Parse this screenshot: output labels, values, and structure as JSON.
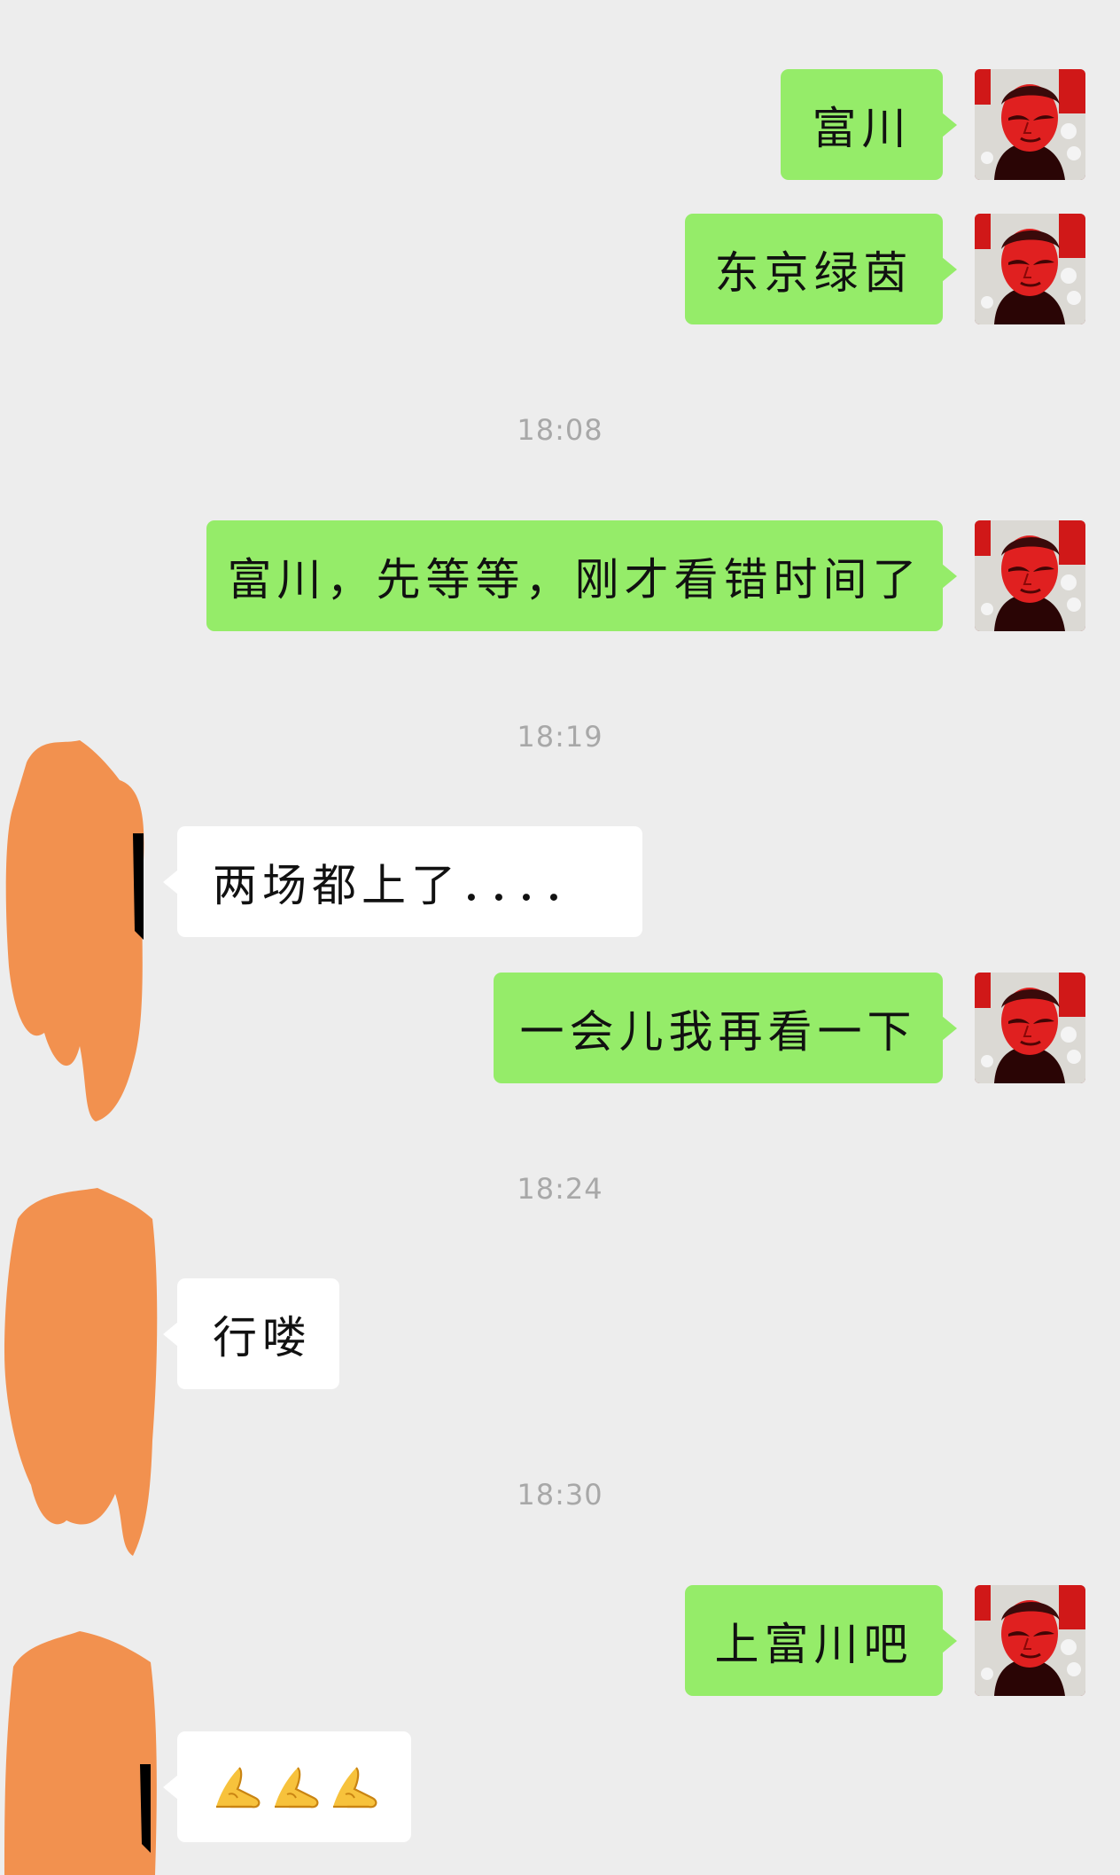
{
  "conversation": {
    "messages": [
      {
        "text": "富川"
      },
      {
        "text": "东京绿茵"
      },
      {
        "text": "富川，先等等，刚才看错时间了"
      },
      {
        "text": "两场都上了．．．．"
      },
      {
        "text": "一会儿我再看一下"
      },
      {
        "text": "行喽"
      },
      {
        "text": "上富川吧"
      },
      {
        "icon": "folded-hands-emoji",
        "count": 3
      }
    ],
    "timestamps": [
      "18:08",
      "18:19",
      "18:24",
      "18:30"
    ]
  },
  "colors": {
    "background": "#ededed",
    "outgoing_bubble": "#95ec69",
    "incoming_bubble": "#ffffff",
    "timestamp": "#a8a8a8",
    "redaction": "#f2914f"
  }
}
